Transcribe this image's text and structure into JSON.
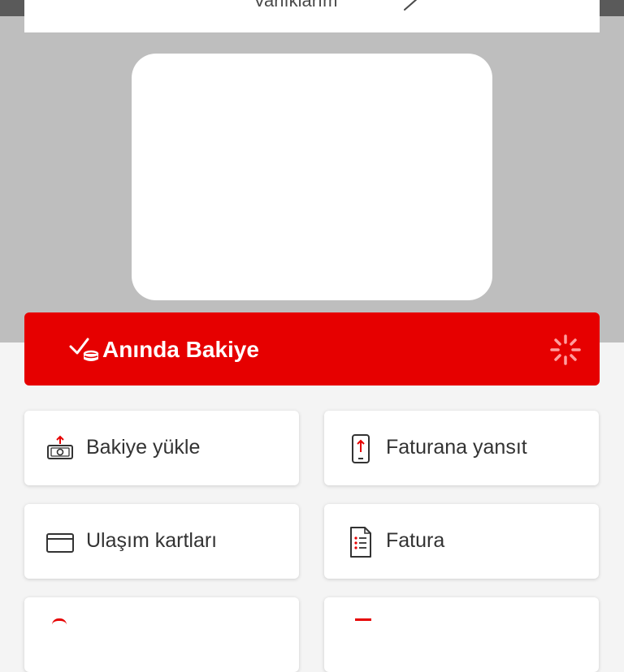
{
  "header": {
    "title": "Varlıklarım",
    "arrow_icon": "arrow-right-icon"
  },
  "instant_balance": {
    "label": "Anında Bakiye",
    "icon": "check-coins-icon",
    "status_icon": "loading-spinner-icon",
    "color": "#e60000"
  },
  "actions": [
    {
      "label": "Bakiye yükle",
      "icon": "cash-upload-icon"
    },
    {
      "label": "Faturana yansıt",
      "icon": "phone-upload-icon"
    },
    {
      "label": "Ulaşım kartları",
      "icon": "card-icon"
    },
    {
      "label": "Fatura",
      "icon": "invoice-document-icon"
    }
  ],
  "colors": {
    "accent": "#e60000",
    "backdrop": "#bebebe",
    "page_background": "#f4f4f4",
    "text": "#333333"
  }
}
